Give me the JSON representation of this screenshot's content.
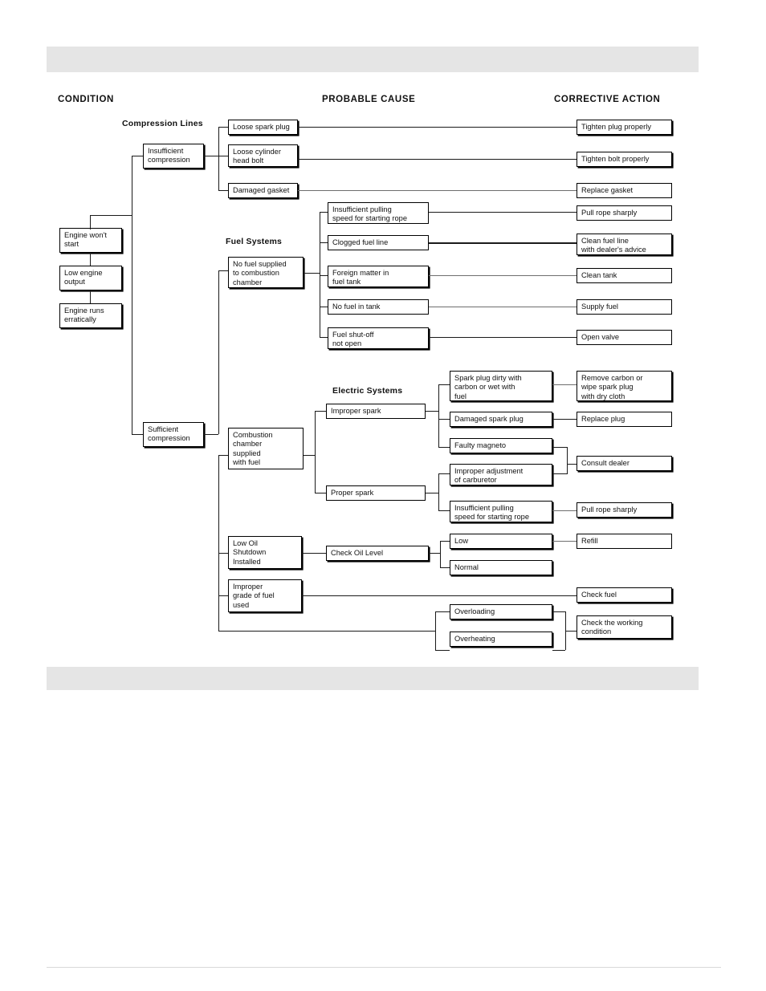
{
  "page": {
    "background_color": "#ffffff",
    "band_color": "#e5e5e5",
    "line_color": "#1a1a1a"
  },
  "headers": {
    "condition": "CONDITION",
    "probable_cause": "PROBABLE CAUSE",
    "corrective_action": "CORRECTIVE ACTION"
  },
  "group_labels": {
    "compression": "Compression Lines",
    "fuel": "Fuel Systems",
    "electric": "Electric Systems"
  },
  "conditions": [
    {
      "id": "cond-engine-wont-start",
      "label": "Engine won't\nstart"
    },
    {
      "id": "cond-low-engine-output",
      "label": "Low engine\noutput"
    },
    {
      "id": "cond-engine-runs-erratically",
      "label": "Engine runs\nerratically"
    }
  ],
  "branches": [
    {
      "id": "branch-insufficient-compression",
      "label": "Insufficient\ncompression"
    },
    {
      "id": "branch-sufficient-compression",
      "label": "Sufficient\ncompression"
    }
  ],
  "causes": {
    "compression": [
      {
        "id": "cause-loose-spark-plug",
        "label": "Loose spark plug"
      },
      {
        "id": "cause-loose-cylinder-head-bolt",
        "label": "Loose cylinder\nhead bolt"
      },
      {
        "id": "cause-damaged-gasket",
        "label": "Damaged gasket"
      }
    ],
    "fuel_parent": {
      "id": "cause-no-fuel-supplied",
      "label": "No fuel supplied\nto combustion\nchamber"
    },
    "fuel": [
      {
        "id": "cause-insufficient-pulling-speed-1",
        "label": "Insufficient pulling\nspeed for starting rope"
      },
      {
        "id": "cause-clogged-fuel-line",
        "label": "Clogged fuel line"
      },
      {
        "id": "cause-foreign-matter-in-fuel-tank",
        "label": "Foreign matter in\nfuel tank"
      },
      {
        "id": "cause-no-fuel-in-tank",
        "label": "No fuel in tank"
      },
      {
        "id": "cause-fuel-shutoff-not-open",
        "label": "Fuel shut-off\nnot open"
      }
    ],
    "electric_parent": {
      "id": "cause-combustion-chamber-supplied",
      "label": "Combustion\nchamber\nsupplied\nwith fuel"
    },
    "spark": [
      {
        "id": "cause-improper-spark",
        "label": "Improper spark"
      },
      {
        "id": "cause-proper-spark",
        "label": "Proper spark"
      }
    ],
    "electric": [
      {
        "id": "cause-spark-plug-dirty",
        "label": "Spark plug dirty with\ncarbon or wet with\nfuel"
      },
      {
        "id": "cause-damaged-spark-plug",
        "label": "Damaged spark plug"
      },
      {
        "id": "cause-faulty-magneto",
        "label": "Faulty magneto"
      },
      {
        "id": "cause-improper-carburetor-adjustment",
        "label": "Improper adjustment\nof carburetor"
      },
      {
        "id": "cause-insufficient-pulling-speed-2",
        "label": "Insufficient pulling\nspeed for starting rope"
      }
    ],
    "oil_parent": {
      "id": "cause-low-oil-shutdown-installed",
      "label": "Low Oil\nShutdown\nInstalled"
    },
    "oil_check": {
      "id": "cause-check-oil-level",
      "label": "Check Oil Level"
    },
    "oil_results": [
      {
        "id": "cause-oil-low",
        "label": "Low"
      },
      {
        "id": "cause-oil-normal",
        "label": "Normal"
      }
    ],
    "fuel_grade": {
      "id": "cause-improper-grade-of-fuel",
      "label": "Improper\ngrade of fuel\nused"
    },
    "load": [
      {
        "id": "cause-overloading",
        "label": "Overloading"
      },
      {
        "id": "cause-overheating",
        "label": "Overheating"
      }
    ]
  },
  "actions": [
    {
      "id": "action-tighten-plug-properly",
      "label": "Tighten plug properly"
    },
    {
      "id": "action-tighten-bolt-properly",
      "label": "Tighten bolt properly"
    },
    {
      "id": "action-replace-gasket",
      "label": "Replace gasket"
    },
    {
      "id": "action-pull-rope-sharply-1",
      "label": "Pull rope sharply"
    },
    {
      "id": "action-clean-fuel-line",
      "label": "Clean fuel line\nwith dealer's advice"
    },
    {
      "id": "action-clean-tank",
      "label": "Clean tank"
    },
    {
      "id": "action-supply-fuel",
      "label": "Supply fuel"
    },
    {
      "id": "action-open-valve",
      "label": "Open valve"
    },
    {
      "id": "action-remove-carbon",
      "label": "Remove carbon or\nwipe spark plug\nwith dry cloth"
    },
    {
      "id": "action-replace-plug",
      "label": "Replace plug"
    },
    {
      "id": "action-consult-dealer",
      "label": "Consult dealer"
    },
    {
      "id": "action-pull-rope-sharply-2",
      "label": "Pull rope sharply"
    },
    {
      "id": "action-refill",
      "label": "Refill"
    },
    {
      "id": "action-check-fuel",
      "label": "Check fuel"
    },
    {
      "id": "action-check-the-working-condition",
      "label": "Check the working\ncondition"
    }
  ]
}
